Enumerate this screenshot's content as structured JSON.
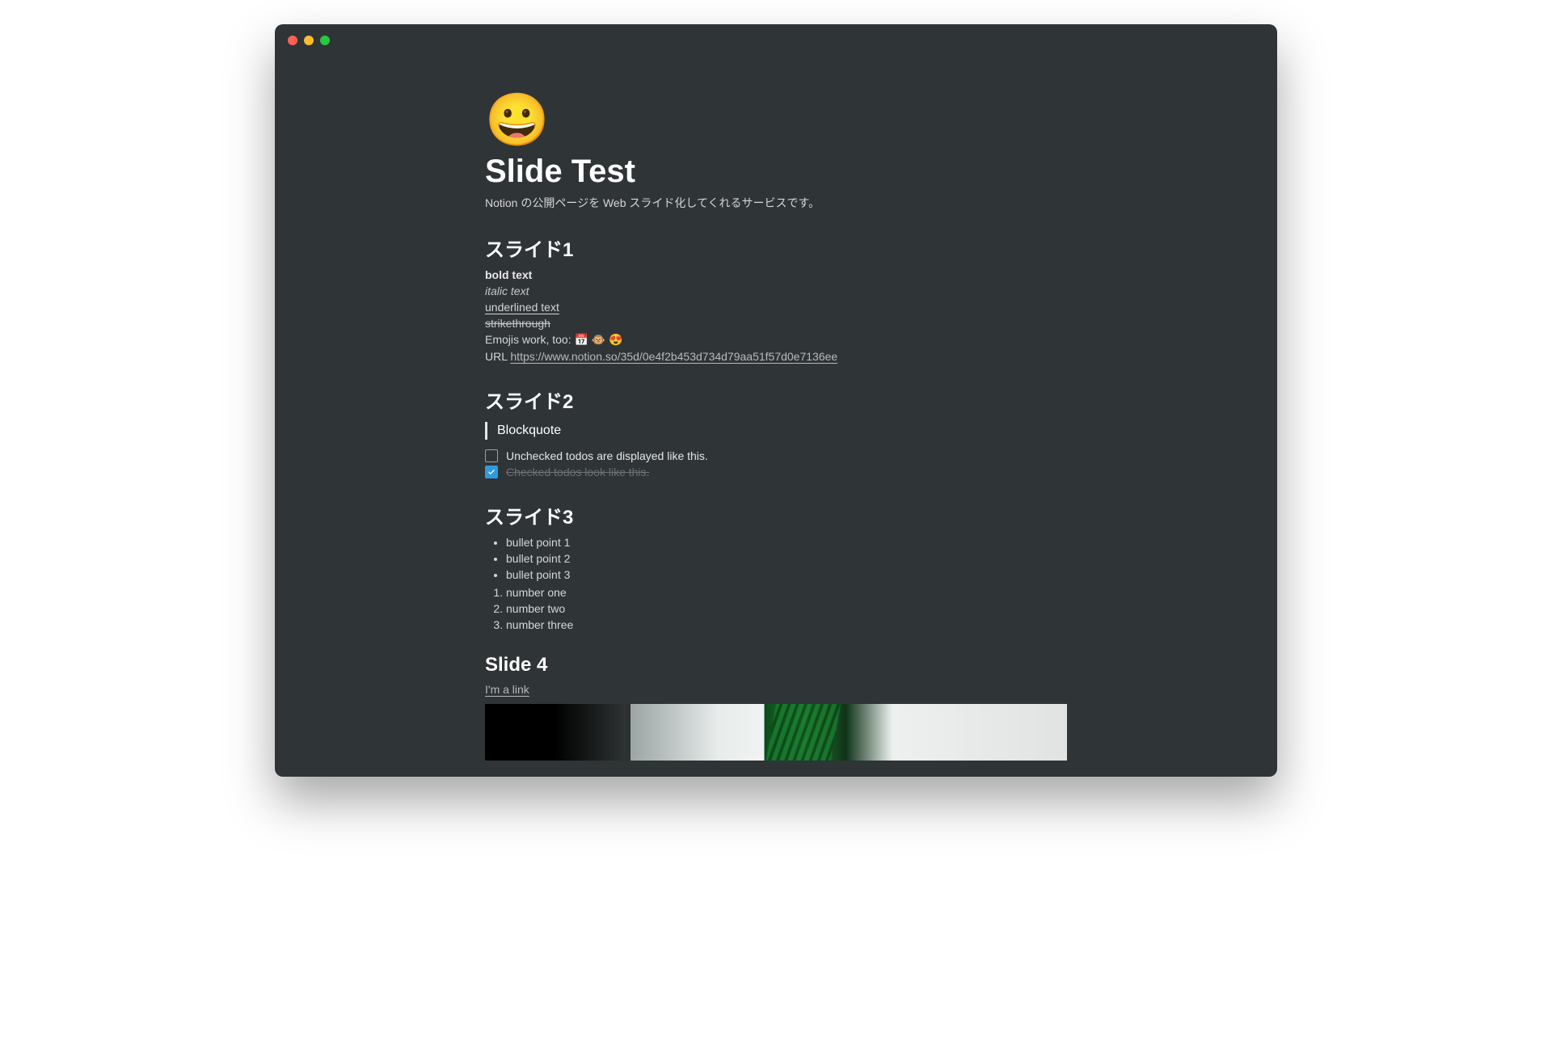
{
  "icon": "😀",
  "title": "Slide Test",
  "description": "Notion の公開ページを Web スライド化してくれるサービスです。",
  "slide1": {
    "heading": "スライド1",
    "bold": "bold text",
    "italic": "italic text",
    "underline": "underlined text",
    "strike": "strikethrough",
    "emoji_line": "Emojis work, too: 📅 🐵 😍",
    "url_label": "URL ",
    "url": "https://www.notion.so/35d/0e4f2b453d734d79aa51f57d0e7136ee"
  },
  "slide2": {
    "heading": "スライド2",
    "blockquote": "Blockquote",
    "todo_unchecked": "Unchecked todos are displayed like this.",
    "todo_checked": "Checked todos look like this."
  },
  "slide3": {
    "heading": "スライド3",
    "bullets": [
      "bullet point 1",
      "bullet point 2",
      "bullet point 3"
    ],
    "numbers": [
      "number one",
      "number two",
      "number three"
    ]
  },
  "slide4": {
    "heading": "Slide 4",
    "link": "I'm a link"
  }
}
